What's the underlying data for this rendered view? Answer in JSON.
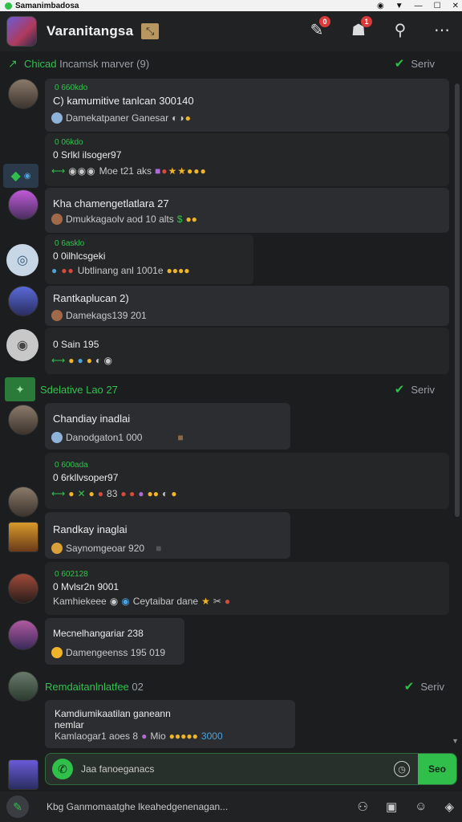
{
  "status": {
    "app": "Samanimbadosa"
  },
  "header": {
    "title": "Varanitangsa",
    "badge_mail": "0",
    "badge_bell": "1"
  },
  "sections": [
    {
      "label_green": "Chicad",
      "label": " Incamsk marver (9)",
      "right": "Seriv"
    },
    {
      "label_green": "Sdelative",
      "label": "  Lao  27",
      "right": "Seriv"
    },
    {
      "label_green": "Remdaitanlnlatfee",
      "label": "  02",
      "right": "Seriv"
    }
  ],
  "messages": [
    {
      "meta": "0 660kdo",
      "line": "C) kamumitive tanlcan  300140",
      "sub": "Damekatpaner Ganesar"
    },
    {
      "meta": "0 06kdo",
      "line": "0 Srlkl ilsoger97",
      "sub": "Moe t21 aks"
    },
    {
      "meta": "",
      "line": "Kha chamengetlatlara  27",
      "sub": "Dmukkagaolv aod 10 alts"
    },
    {
      "meta": "0 6asklo",
      "line": "0 0ilhlcsgeki",
      "sub": "Ubtlinang anl 1001e"
    },
    {
      "meta": "",
      "line": "Rantkaplucan  2)",
      "sub": "Damekags139 201"
    },
    {
      "meta": "",
      "line": "0 Sain 195",
      "sub": ""
    },
    {
      "meta": "",
      "line": "Chandiay inadlai",
      "sub": "Danodgaton1 000"
    },
    {
      "meta": "0 600ada",
      "line": "0 6rkllvsoper97",
      "sub": "83"
    },
    {
      "meta": "",
      "line": "Randkay inaglai",
      "sub": "Saynomgeoar 920"
    },
    {
      "meta": "0 602128",
      "line": "0 Mvlsr2n 9001",
      "sub": "Kamhiekeee",
      "sub2": "Ceytaibar  dane"
    },
    {
      "meta": "",
      "line": "Mecnelhangariar 238",
      "sub": "Damengeenss 195 019"
    },
    {
      "meta": "",
      "line": "Kamdiumikaatilan ganeann",
      "line2": "nemlar",
      "sub": "Kamlaogar1 aoes 8",
      "sub2": "Mio",
      "count": "3000"
    }
  ],
  "composer": {
    "placeholder": "Jaa fanoeganacs",
    "send": "Seo"
  },
  "bottom": {
    "text": "Kbg Ganmomaatghe lkeahedgenenagan..."
  }
}
